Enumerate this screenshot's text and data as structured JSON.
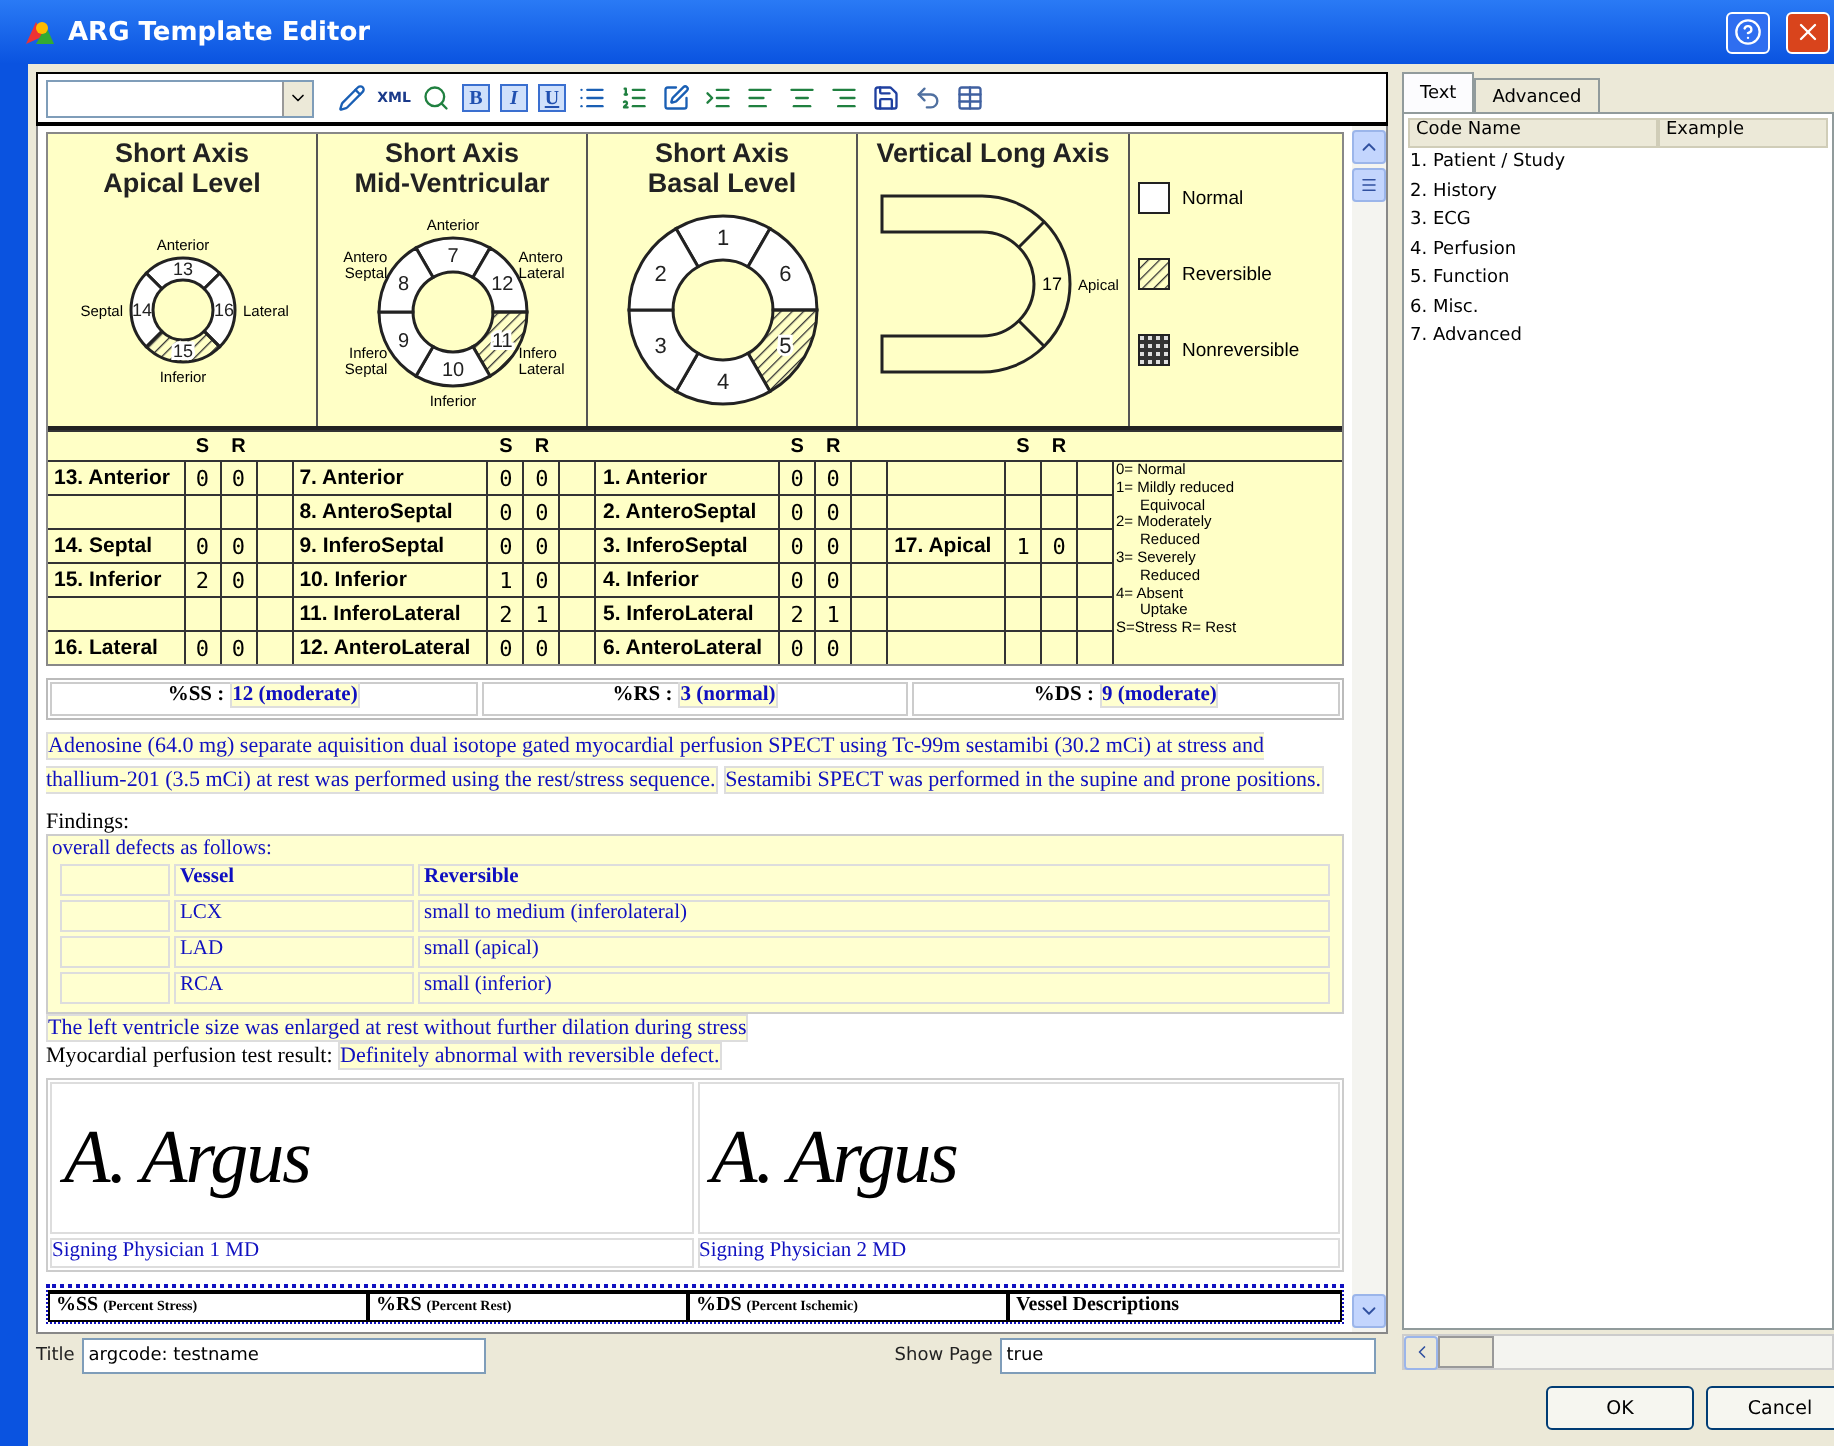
{
  "window": {
    "title": "ARG Template Editor"
  },
  "toolbar": {
    "xml_label": "XML",
    "format_buttons": [
      {
        "label": "B"
      },
      {
        "label": "I"
      },
      {
        "label": "U"
      }
    ]
  },
  "diagram": {
    "panels": [
      {
        "kind": "ring",
        "title_lines": [
          "Short Axis",
          "Apical Level"
        ],
        "segments": [
          {
            "number": "13",
            "reversible": false
          },
          {
            "number": "16",
            "reversible": false
          },
          {
            "number": "15",
            "reversible": true
          },
          {
            "number": "14",
            "reversible": false
          }
        ],
        "labels": [
          "Anterior",
          "Lateral",
          "Inferior",
          "Septal"
        ]
      },
      {
        "kind": "ring",
        "title_lines": [
          "Short Axis",
          "Mid-Ventricular"
        ],
        "segments": [
          {
            "number": "7",
            "reversible": false
          },
          {
            "number": "12",
            "reversible": false
          },
          {
            "number": "11",
            "reversible": true
          },
          {
            "number": "10",
            "reversible": false
          },
          {
            "number": "9",
            "reversible": false
          },
          {
            "number": "8",
            "reversible": false
          }
        ],
        "labels": [
          "Anterior",
          "Antero Lateral",
          "Infero Lateral",
          "Inferior",
          "Infero Septal",
          "Antero Septal"
        ]
      },
      {
        "kind": "ring",
        "title_lines": [
          "Short Axis",
          "Basal Level"
        ],
        "segments": [
          {
            "number": "1",
            "reversible": false
          },
          {
            "number": "6",
            "reversible": false
          },
          {
            "number": "5",
            "reversible": true
          },
          {
            "number": "4",
            "reversible": false
          },
          {
            "number": "3",
            "reversible": false
          },
          {
            "number": "2",
            "reversible": false
          }
        ]
      },
      {
        "kind": "long_axis",
        "title_lines": [
          "Vertical Long Axis"
        ],
        "segments": [
          {
            "number": "17",
            "reversible": false
          }
        ],
        "labels": [
          "Apical"
        ]
      },
      {
        "kind": "legend",
        "items": [
          {
            "kind": "normal",
            "label": "Normal"
          },
          {
            "kind": "reversible",
            "label": "Reversible"
          },
          {
            "kind": "nonreversible",
            "label": "Nonreversible"
          }
        ]
      }
    ]
  },
  "score_table": {
    "groups": [
      {
        "header_s": "S",
        "header_r": "R",
        "rows": [
          {
            "segment": "13. Anterior",
            "s": "0",
            "r": "0"
          },
          {},
          {
            "segment": "14. Septal",
            "s": "0",
            "r": "0"
          },
          {
            "segment": "15. Inferior",
            "s": "2",
            "r": "0"
          },
          {},
          {
            "segment": "16. Lateral",
            "s": "0",
            "r": "0"
          }
        ]
      },
      {
        "header_s": "S",
        "header_r": "R",
        "rows": [
          {
            "segment": "7. Anterior",
            "s": "0",
            "r": "0"
          },
          {
            "segment": "8. AnteroSeptal",
            "s": "0",
            "r": "0"
          },
          {
            "segment": "9. InferoSeptal",
            "s": "0",
            "r": "0"
          },
          {
            "segment": "10. Inferior",
            "s": "1",
            "r": "0"
          },
          {
            "segment": "11. InferoLateral",
            "s": "2",
            "r": "1"
          },
          {
            "segment": "12. AnteroLateral",
            "s": "0",
            "r": "0"
          }
        ]
      },
      {
        "header_s": "S",
        "header_r": "R",
        "rows": [
          {
            "segment": "1. Anterior",
            "s": "0",
            "r": "0"
          },
          {
            "segment": "2. AnteroSeptal",
            "s": "0",
            "r": "0"
          },
          {
            "segment": "3. InferoSeptal",
            "s": "0",
            "r": "0"
          },
          {
            "segment": "4. Inferior",
            "s": "0",
            "r": "0"
          },
          {
            "segment": "5. InferoLateral",
            "s": "2",
            "r": "1"
          },
          {
            "segment": "6. AnteroLateral",
            "s": "0",
            "r": "0"
          }
        ]
      },
      {
        "header_s": "S",
        "header_r": "R",
        "rows": [
          {},
          {},
          {
            "segment": "17. Apical",
            "s": "1",
            "r": "0"
          },
          {},
          {},
          {}
        ]
      }
    ],
    "scale_legend": [
      "0= Normal",
      "1= Mildly reduced",
      "Equivocal",
      "2= Moderately",
      "Reduced",
      "3= Severely",
      "Reduced",
      "4= Absent",
      "Uptake",
      "S=Stress R= Rest"
    ]
  },
  "scores": [
    {
      "label": "%SS :",
      "value": "12 (moderate)"
    },
    {
      "label": "%RS :",
      "value": "3 (normal)"
    },
    {
      "label": "%DS :",
      "value": "9 (moderate)"
    }
  ],
  "procedure": [
    "Adenosine (64.0 mg) separate aquisition dual isotope gated myocardial perfusion SPECT using Tc-99m sestamibi (30.2 mCi) at stress and thallium-201 (3.5 mCi) at rest was performed using the rest/stress sequence.",
    "Sestamibi SPECT was performed in the supine and prone positions."
  ],
  "findings": {
    "label": "Findings:",
    "intro": "overall defects as follows:",
    "columns": [
      "Vessel",
      "Reversible"
    ],
    "rows": [
      {
        "vessel": "LCX",
        "reversible": "small to medium (inferolateral)"
      },
      {
        "vessel": "LAD",
        "reversible": "small (apical)"
      },
      {
        "vessel": "RCA",
        "reversible": "small (inferior)"
      }
    ]
  },
  "lv_statement": "The left ventricle size was enlarged at rest without further dilation during stress",
  "result": {
    "label": "Myocardial perfusion test result:",
    "value": "Definitely abnormal with reversible defect."
  },
  "signatures": [
    {
      "signature": "A. Argus",
      "caption": "Signing Physician 1 MD"
    },
    {
      "signature": "A. Argus",
      "caption": "Signing Physician 2 MD"
    }
  ],
  "footer_columns": [
    {
      "label": "%SS",
      "note": "(Percent Stress)"
    },
    {
      "label": "%RS",
      "note": "(Percent Rest)"
    },
    {
      "label": "%DS",
      "note": "(Percent Ischemic)"
    },
    {
      "label": "Vessel Descriptions"
    }
  ],
  "fields": [
    {
      "label": "Title",
      "value": "argcode: testname"
    },
    {
      "label": "Show Page",
      "value": "true"
    }
  ],
  "side_panel": {
    "tabs": [
      {
        "label": "Text",
        "selected": true
      },
      {
        "label": "Advanced",
        "selected": false
      }
    ],
    "columns": [
      "Code Name",
      "Example"
    ],
    "items": [
      "1. Patient / Study",
      "2. History",
      "3. ECG",
      "4. Perfusion",
      "5. Function",
      "6. Misc.",
      "7. Advanced"
    ]
  },
  "buttons": [
    "OK",
    "Cancel"
  ]
}
